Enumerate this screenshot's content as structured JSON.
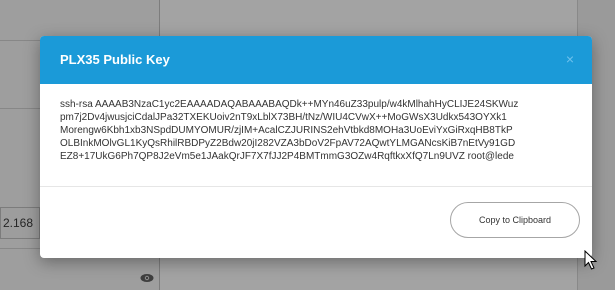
{
  "background": {
    "ip_fragment": "2.168",
    "eye_icon": "eye-icon"
  },
  "modal": {
    "title": "PLX35 Public Key",
    "close_symbol": "×",
    "key_lines": [
      "ssh-rsa AAAAB3NzaC1yc2EAAAADAQABAAABAQDk++MYn46uZ33pulp/w4kMlhahHyCLIJE24SKWuz",
      "pm7j2Dv4jwusjciCdalJPa32TXEKUoiv2nT9xLblX73BH/tNz/WIU4CVwX++MoGWsX3Udkx543OYXk1",
      "Morengw6Kbh1xb3NSpdDUMYOMUR/zjIM+AcalCZJURINS2ehVtbkd8MOHa3UoEviYxGiRxqHB8TkP",
      "OLBInkMOlvGL1KyQsRhilRBDPyZ2Bdw20jI282VZA3bDoV2FpAV72AQwtYLMGANcsKiB7nEtVy91GD",
      "EZ8+17UkG6Ph7QP8J2eVm5e1JAakQrJF7X7fJJ2P4BMTmmG3OZw4RqftkxXfQ7Ln9UVZ root@lede"
    ],
    "copy_button_label": "Copy to Clipboard"
  },
  "colors": {
    "header": "#1b9ad8",
    "title_text": "#ffffff"
  }
}
